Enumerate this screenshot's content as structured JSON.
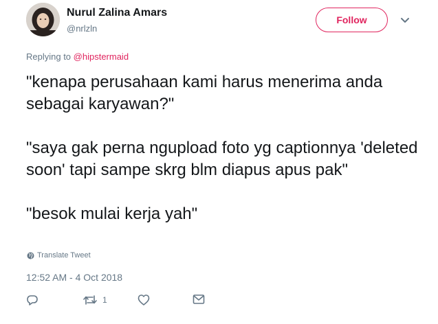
{
  "author": {
    "display_name": "Nurul Zalina Amars",
    "handle": "@nrlzln"
  },
  "follow_label": "Follow",
  "reply_context": {
    "prefix": "Replying to ",
    "mention": "@hipstermaid"
  },
  "tweet": {
    "paragraphs": [
      "\"kenapa perusahaan kami harus menerima anda sebagai karyawan?\"",
      "\"saya gak perna ngupload foto yg captionnya 'deleted soon' tapi sampe skrg blm diapus apus pak\"",
      "\"besok mulai kerja yah\""
    ]
  },
  "translate_label": "Translate Tweet",
  "timestamp": "12:52 AM - 4 Oct 2018",
  "actions": {
    "retweet_count": "1"
  },
  "colors": {
    "accent": "#e0245e",
    "secondary_text": "#657786",
    "primary_text": "#14171a"
  },
  "icons": [
    "reply-icon",
    "retweet-icon",
    "like-icon",
    "message-icon",
    "globe-icon",
    "chevron-down-icon"
  ]
}
